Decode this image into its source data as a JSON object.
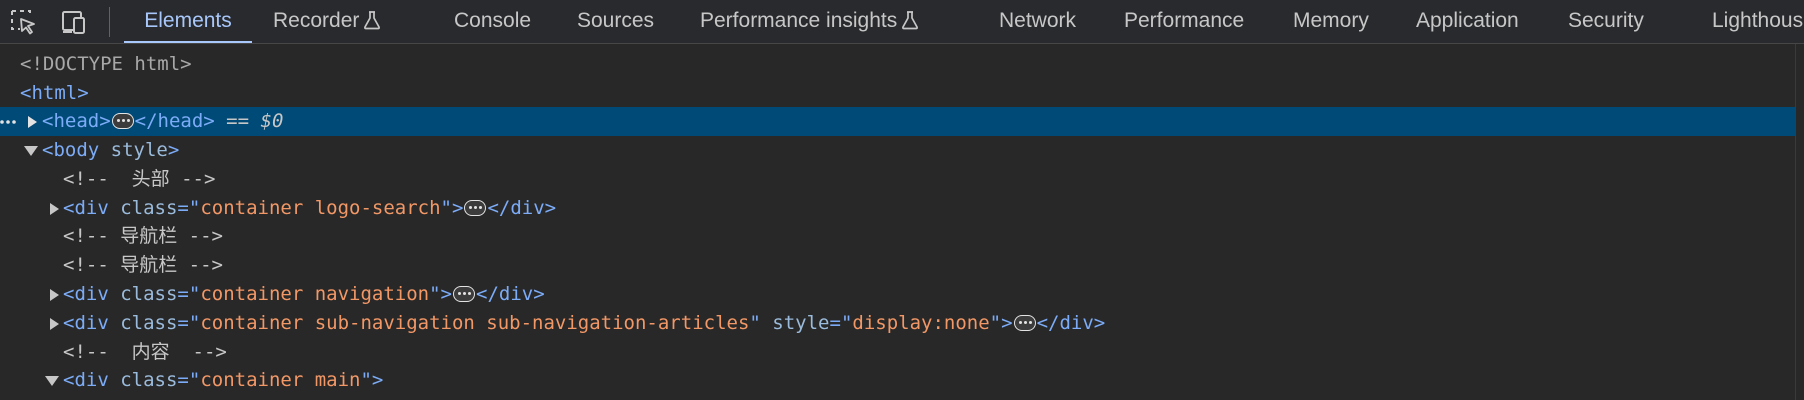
{
  "toolbar": {
    "inspect_icon": "inspect-element-icon",
    "device_icon": "device-toolbar-icon"
  },
  "tabs": [
    {
      "label": "Elements",
      "active": true,
      "experimental": false
    },
    {
      "label": "Recorder",
      "active": false,
      "experimental": true
    },
    {
      "label": "Console",
      "active": false,
      "experimental": false
    },
    {
      "label": "Sources",
      "active": false,
      "experimental": false
    },
    {
      "label": "Performance insights",
      "active": false,
      "experimental": true
    },
    {
      "label": "Network",
      "active": false,
      "experimental": false
    },
    {
      "label": "Performance",
      "active": false,
      "experimental": false
    },
    {
      "label": "Memory",
      "active": false,
      "experimental": false
    },
    {
      "label": "Application",
      "active": false,
      "experimental": false
    },
    {
      "label": "Security",
      "active": false,
      "experimental": false
    },
    {
      "label": "Lighthouse",
      "active": false,
      "experimental": false
    }
  ],
  "colors": {
    "accent": "#a8c7fa",
    "selected_row": "#004a77",
    "tag": "#7cacf8",
    "attr_value": "#f29766"
  },
  "tree": {
    "doctype": "<!DOCTYPE html>",
    "html_open": "<html>",
    "head_open": "<head>",
    "head_close": "</head>",
    "selected_marker": "== ",
    "selected_var": "$0",
    "body_open": "<body",
    "body_attr": "style",
    "body_close_bracket": ">",
    "comment_header": "<!--  头部 -->",
    "comment_nav_1": "<!-- 导航栏 -->",
    "comment_nav_2": "<!-- 导航栏 -->",
    "comment_content": "<!--  内容  -->",
    "div_open": "<div",
    "div_close": "</div>",
    "attr_class": "class",
    "attr_style": "style",
    "eq_quote": "=\"",
    "quote": "\"",
    "gt": ">",
    "val_logo_search": "container logo-search",
    "val_navigation": "container navigation",
    "val_sub_navigation": "container sub-navigation sub-navigation-articles",
    "val_display_none": "display:none",
    "val_main": "container main"
  }
}
